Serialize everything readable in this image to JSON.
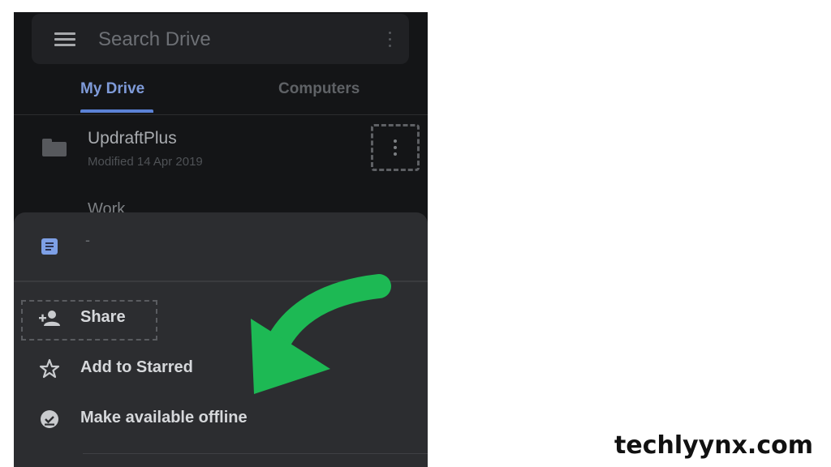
{
  "search": {
    "placeholder": "Search Drive"
  },
  "tabs": [
    {
      "label": "My Drive",
      "active": true
    },
    {
      "label": "Computers",
      "active": false
    }
  ],
  "files": [
    {
      "name": "UpdraftPlus",
      "modified": "Modified 14 Apr 2019",
      "icon": "folder-icon"
    },
    {
      "name": "Work",
      "icon": "folder-icon"
    }
  ],
  "sheet": {
    "title": "-",
    "items": [
      {
        "label": "Share",
        "icon": "person-add-icon"
      },
      {
        "label": "Add to Starred",
        "icon": "star-outline-icon"
      },
      {
        "label": "Make available offline",
        "icon": "offline-check-icon"
      }
    ]
  },
  "annotation": {
    "arrow_color": "#1db954"
  },
  "watermark": "techlyynx.com",
  "colors": {
    "accent": "#7f9bd9",
    "background": "#141517",
    "sheet": "#2c2d30"
  }
}
